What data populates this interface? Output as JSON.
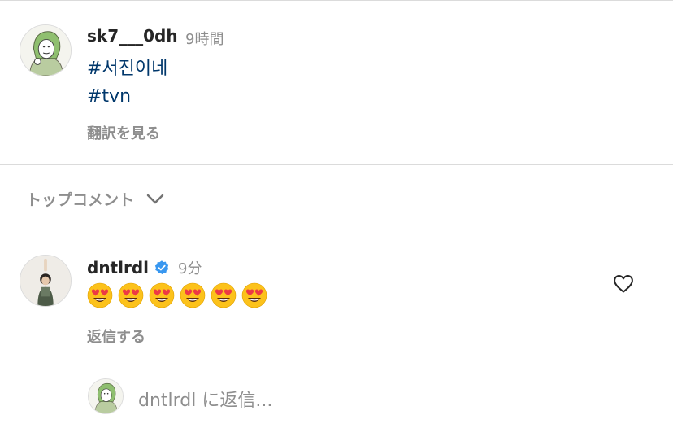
{
  "post": {
    "username": "sk7___0dh",
    "time": "9時間",
    "hashtags": [
      "#서진이네",
      "#tvn"
    ],
    "translate_label": "翻訳を見る"
  },
  "comments_header": {
    "sort_label": "トップコメント",
    "chevron_icon": "chevron-down-icon"
  },
  "comment": {
    "username": "dntlrdl",
    "verified_icon": "verified-badge-icon",
    "verified_color": "#3897f0",
    "time": "9分",
    "emoji_count": 6,
    "emoji_name": "heart-eyes-emoji",
    "reply_label": "返信する",
    "like_icon": "heart-outline-icon"
  },
  "reply_box": {
    "placeholder": "dntlrdl に返信..."
  },
  "colors": {
    "link": "#00376b",
    "muted": "#8e8e8e",
    "divider": "#dbdbdb"
  }
}
